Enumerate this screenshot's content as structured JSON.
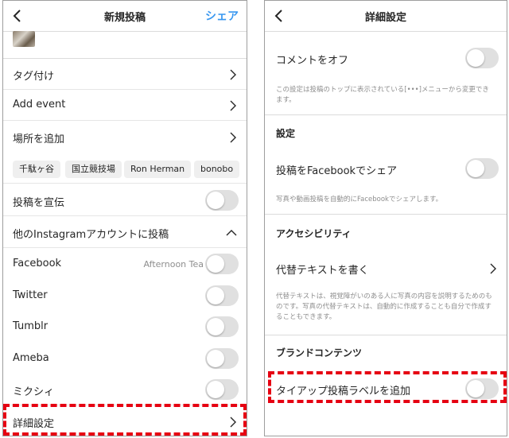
{
  "left": {
    "header": {
      "title": "新規投稿",
      "share": "シェア"
    },
    "rows": {
      "tag": "タグ付け",
      "event": "Add event",
      "location": "場所を追加",
      "promote": "投稿を宣伝",
      "other_accounts": "他のInstagramアカウントに投稿",
      "facebook": "Facebook",
      "facebook_sub": "Afternoon Tea",
      "twitter": "Twitter",
      "tumblr": "Tumblr",
      "ameba": "Ameba",
      "mixi": "ミクシィ",
      "advanced": "詳細設定"
    },
    "chips": [
      "千駄ヶ谷",
      "国立競技場",
      "Ron Herman",
      "bonobo"
    ]
  },
  "right": {
    "header": {
      "title": "詳細設定"
    },
    "comments_off": "コメントをオフ",
    "comments_note": "この設定は投稿のトップに表示されている[•••]メニューから変更できます。",
    "settings_heading": "設定",
    "share_fb": "投稿をFacebookでシェア",
    "share_fb_note": "写真や動画投稿を自動的にFacebookでシェアします。",
    "accessibility_heading": "アクセシビリティ",
    "alt_text": "代替テキストを書く",
    "alt_text_note": "代替テキストは、視覚障がいのある人に写真の内容を説明するためのものです。写真の代替テキストは、自動的に作成することも自分で作成することもできます。",
    "brand_heading": "ブランドコンテンツ",
    "paid_partnership": "タイアップ投稿ラベルを追加"
  },
  "colors": {
    "accent": "#3897f0",
    "highlight": "#e60012",
    "toggle_off": "#e0e0e0"
  }
}
